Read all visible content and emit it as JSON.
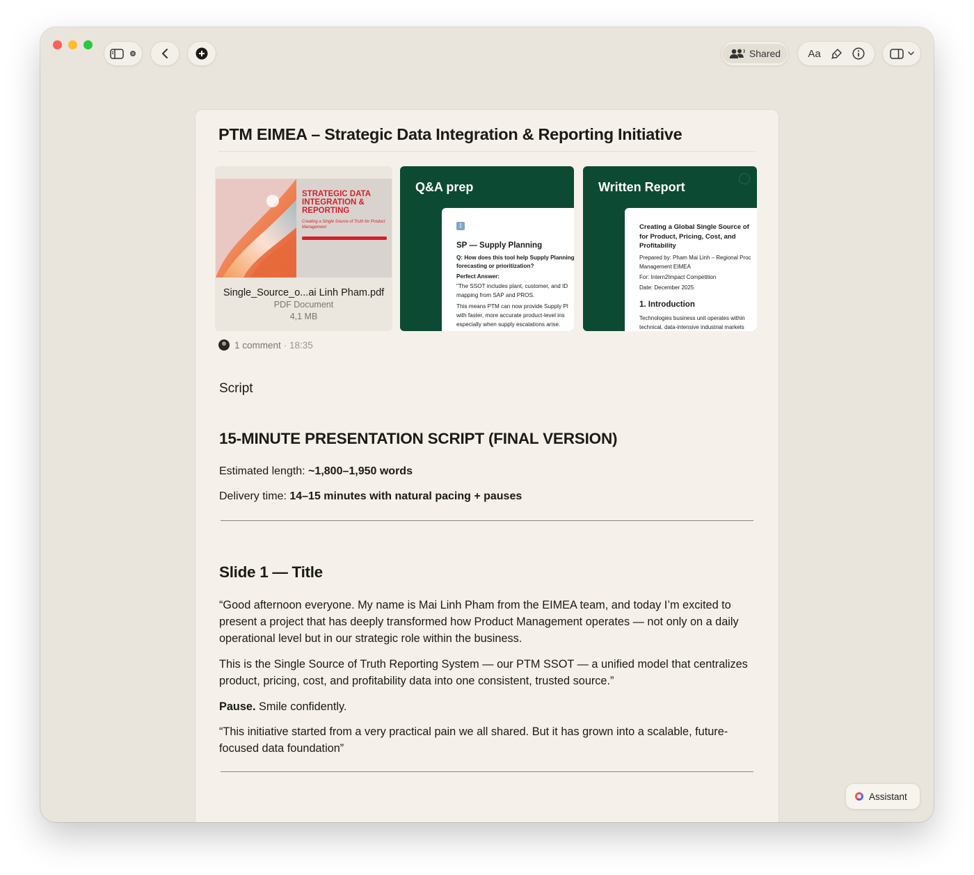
{
  "toolbar": {
    "shared_label": "Shared",
    "font_label": "Aa"
  },
  "document": {
    "title": "PTM EIMEA – Strategic Data Integration & Reporting Initiative"
  },
  "attachments": {
    "pdf": {
      "thumb_title": "STRATEGIC DATA INTEGRATION & REPORTING",
      "thumb_subtitle": "Creating a Single Source of Truth for Product Management",
      "file_name": "Single_Source_o...ai Linh Pham.pdf",
      "file_type": "PDF Document",
      "file_size": "4,1 MB"
    },
    "qa": {
      "title": "Q&A prep",
      "badge": "1",
      "heading": "SP — Supply Planning",
      "q1": "Q: How does this tool help Supply Planning",
      "q2": "forecasting or prioritization?",
      "answer_label": "Perfect Answer:",
      "l1": "\"The SSOT includes plant, customer, and ID",
      "l2": "mapping from SAP and PROS.",
      "l3": "This means PTM can now provide Supply Pl",
      "l4": "with faster, more accurate product-level ins",
      "l5": "especially when supply escalations arise."
    },
    "report": {
      "title": "Written Report",
      "h1": "Creating a Global Single Source of",
      "h2": "for Product, Pricing, Cost, and",
      "h3": "Profitability",
      "prep1": "Prepared by: Pham Mai Linh – Regional Proc",
      "prep2": "Management EIMEA",
      "for": "For: Intern2Impact Competition",
      "date": "Date: December 2025",
      "section": "1. Introduction",
      "t1": "Technologies business unit operates within",
      "t2": "technical, data-intensive industrial markets"
    }
  },
  "comment": {
    "count": "1 comment",
    "time": "· 18:35"
  },
  "content": {
    "section_label": "Script",
    "heading": "15-MINUTE PRESENTATION SCRIPT (FINAL VERSION)",
    "length_label": "Estimated length: ",
    "length_value": "~1,800–1,950 words",
    "delivery_label": "Delivery time: ",
    "delivery_value": "14–15 minutes with natural pacing + pauses",
    "slide_heading": "Slide 1 — Title",
    "para1": "“Good afternoon everyone. My name is Mai Linh Pham from the EIMEA team, and today I’m excited to present a project that has deeply transformed how Product Management operates — not only on a daily operational level but in our strategic role within the business.",
    "para2": "This is the Single Source of Truth Reporting System — our PTM SSOT — a unified model that centralizes product, pricing, cost, and profitability data into one consistent, trusted source.”",
    "pause_label": "Pause.",
    "pause_text": " Smile confidently.",
    "para4": "“This initiative started from a very practical pain we all shared. But it has grown into a scalable, future-focused data foundation”"
  },
  "assistant": {
    "label": "Assistant"
  }
}
